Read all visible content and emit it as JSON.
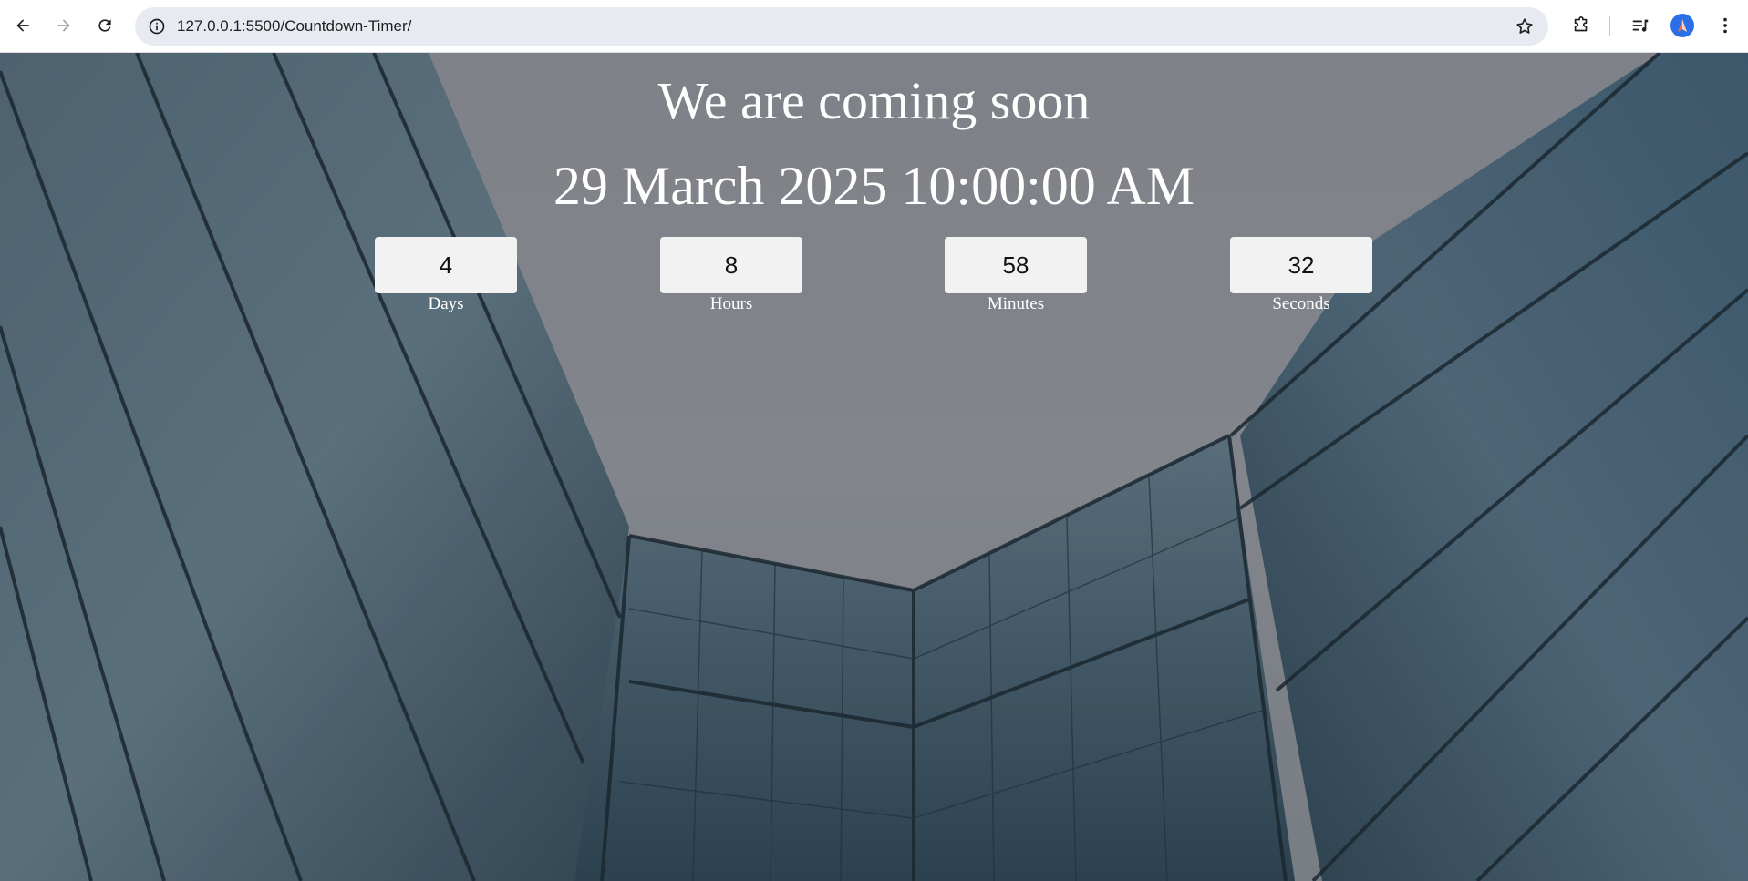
{
  "browser": {
    "url": "127.0.0.1:5500/Countdown-Timer/",
    "icons": {
      "back": "back-arrow-icon",
      "forward": "forward-arrow-icon",
      "reload": "reload-icon",
      "site_info": "site-info-icon",
      "bookmark": "star-icon",
      "extensions": "puzzle-icon",
      "media": "media-controls-icon",
      "menu": "kebab-menu-icon"
    }
  },
  "page": {
    "headline": "We are coming soon",
    "target_date": "29 March 2025 10:00:00 AM",
    "countdown": [
      {
        "value": "4",
        "label": "Days"
      },
      {
        "value": "8",
        "label": "Hours"
      },
      {
        "value": "58",
        "label": "Minutes"
      },
      {
        "value": "32",
        "label": "Seconds"
      }
    ]
  },
  "colors": {
    "text": "#ffffff",
    "box_bg": "#f2f2f2",
    "box_text": "#111111"
  }
}
